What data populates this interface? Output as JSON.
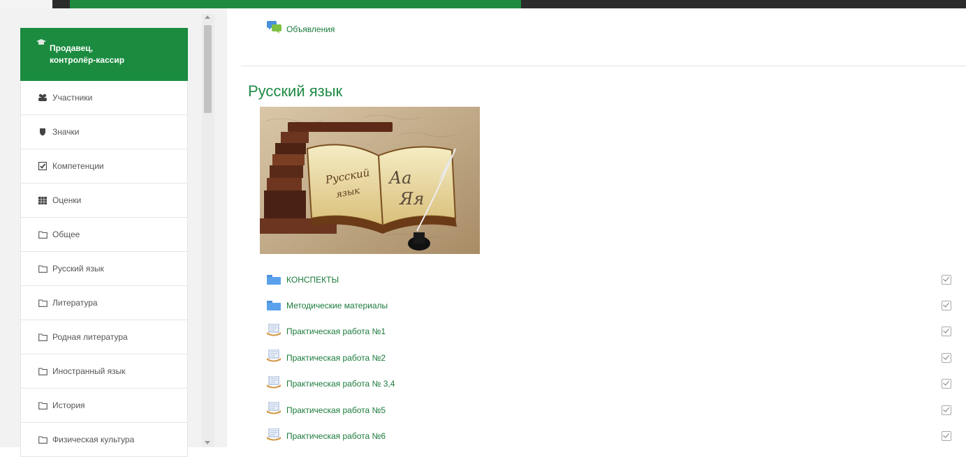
{
  "colors": {
    "accent": "#1a8b3f",
    "link": "#1a7a3a",
    "title": "#1e8a44"
  },
  "nav": {
    "active": {
      "label_line1": "Продавец,",
      "label_line2": "контролёр-кассир",
      "icon": "graduation-cap-icon"
    },
    "items": [
      {
        "label": "Участники",
        "icon": "users-icon"
      },
      {
        "label": "Значки",
        "icon": "shield-icon"
      },
      {
        "label": "Компетенции",
        "icon": "checkbox-icon"
      },
      {
        "label": "Оценки",
        "icon": "table-icon"
      },
      {
        "label": "Общее",
        "icon": "folder-outline-icon"
      },
      {
        "label": "Русский язык",
        "icon": "folder-outline-icon"
      },
      {
        "label": "Литература",
        "icon": "folder-outline-icon"
      },
      {
        "label": "Родная литература",
        "icon": "folder-outline-icon"
      },
      {
        "label": "Иностранный язык",
        "icon": "folder-outline-icon"
      },
      {
        "label": "История",
        "icon": "folder-outline-icon"
      },
      {
        "label": "Физическая культура",
        "icon": "folder-outline-icon"
      }
    ]
  },
  "main": {
    "announcements": "Объявления",
    "section_title": "Русский язык",
    "image_text": {
      "left_page_1": "Русский",
      "left_page_2": "язык",
      "right_page_1": "Аа",
      "right_page_2": "Яя"
    },
    "activities": [
      {
        "label": "КОНСПЕКТЫ",
        "type": "folder"
      },
      {
        "label": "Методические материалы",
        "type": "folder"
      },
      {
        "label": "Практическая работа №1",
        "type": "assignment"
      },
      {
        "label": "Практическая работа №2",
        "type": "assignment"
      },
      {
        "label": "Практическая работа № 3,4",
        "type": "assignment"
      },
      {
        "label": "Практическая работа №5",
        "type": "assignment"
      },
      {
        "label": "Практическая работа №6",
        "type": "assignment"
      }
    ]
  }
}
